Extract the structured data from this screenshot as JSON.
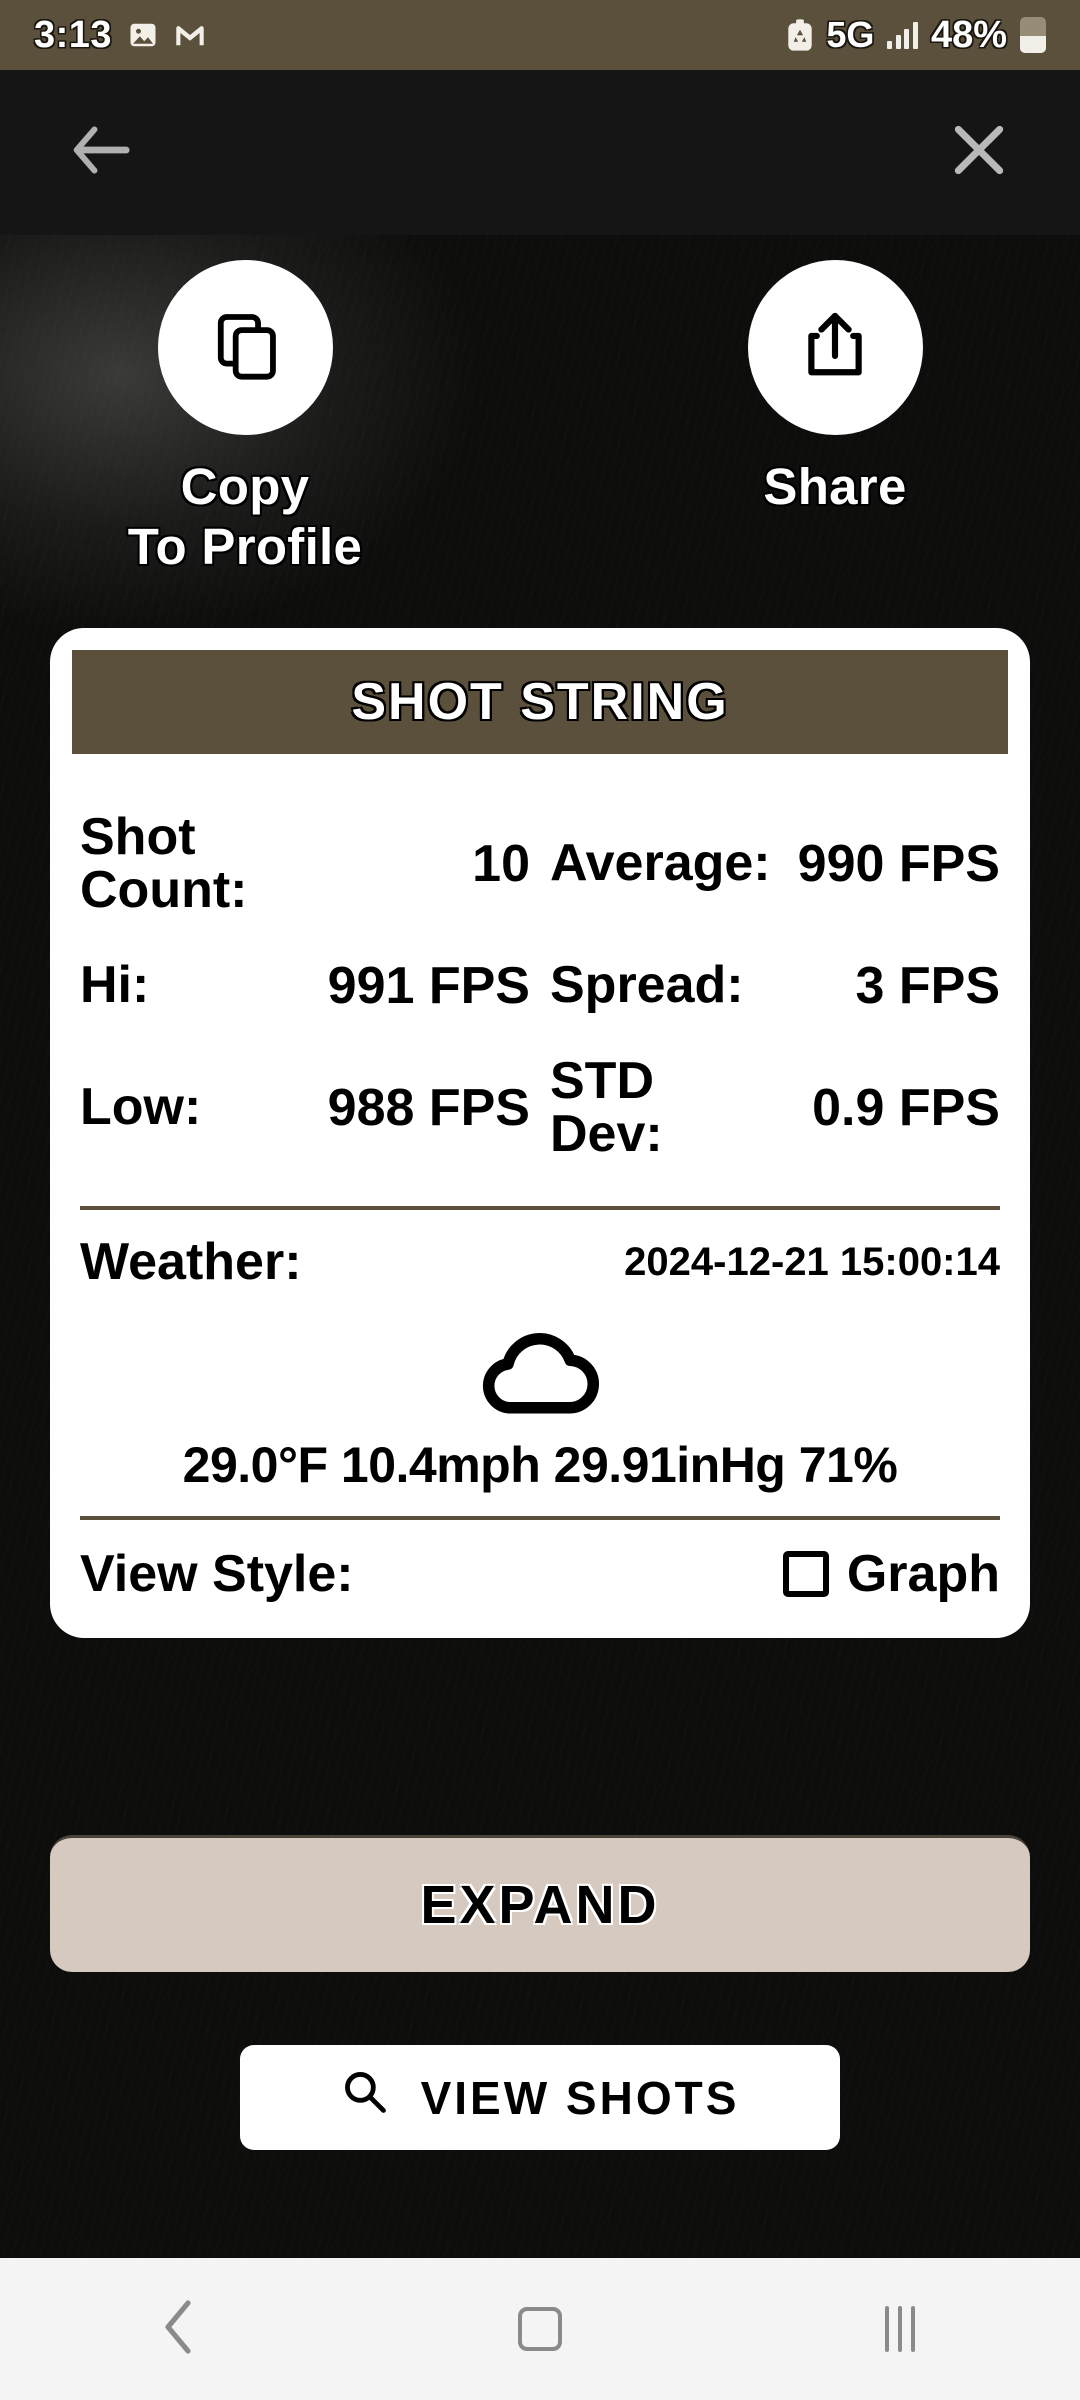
{
  "status_bar": {
    "time": "3:13",
    "network": "5G",
    "battery_percent": "48%",
    "icons": [
      "photo-icon",
      "gmail-icon",
      "app-icon",
      "signal-icon",
      "battery-icon"
    ]
  },
  "top_nav": {
    "back_label": "back-arrow",
    "close_label": "close"
  },
  "actions": [
    {
      "id": "copy-to-profile",
      "icon": "copy-icon",
      "label": "Copy\nTo Profile"
    },
    {
      "id": "share",
      "icon": "share-icon",
      "label": "Share"
    }
  ],
  "action_labels": {
    "copy_line1": "Copy",
    "copy_line2": "To Profile",
    "share": "Share"
  },
  "card": {
    "title": "SHOT STRING",
    "stats": {
      "shot_count_label": "Shot Count:",
      "shot_count_value": "10",
      "average_label": "Average:",
      "average_value": "990 FPS",
      "hi_label": "Hi:",
      "hi_value": "991 FPS",
      "spread_label": "Spread:",
      "spread_value": "3 FPS",
      "low_label": "Low:",
      "low_value": "988 FPS",
      "std_dev_label": "STD Dev:",
      "std_dev_value": "0.9 FPS"
    },
    "weather": {
      "label": "Weather:",
      "timestamp": "2024-12-21 15:00:14",
      "icon": "cloud-icon",
      "temperature": "29.0°F",
      "wind": "10.4mph",
      "pressure": "29.91inHg",
      "humidity": "71%",
      "summary": "29.0°F 10.4mph 29.91inHg 71%"
    },
    "view_style": {
      "label": "View Style:",
      "option_label": "Graph",
      "checked": false
    }
  },
  "buttons": {
    "expand": "EXPAND",
    "view_shots": "VIEW SHOTS",
    "view_shots_icon": "search-icon"
  },
  "system_nav": {
    "back": "back-chevron-icon",
    "home": "home-icon",
    "recents": "recents-icon"
  },
  "colors": {
    "brand_brown": "#5B503C",
    "expand_bg": "#D5C9C0",
    "card_bg": "#FFFFFF",
    "topnav_bg": "#151515"
  }
}
